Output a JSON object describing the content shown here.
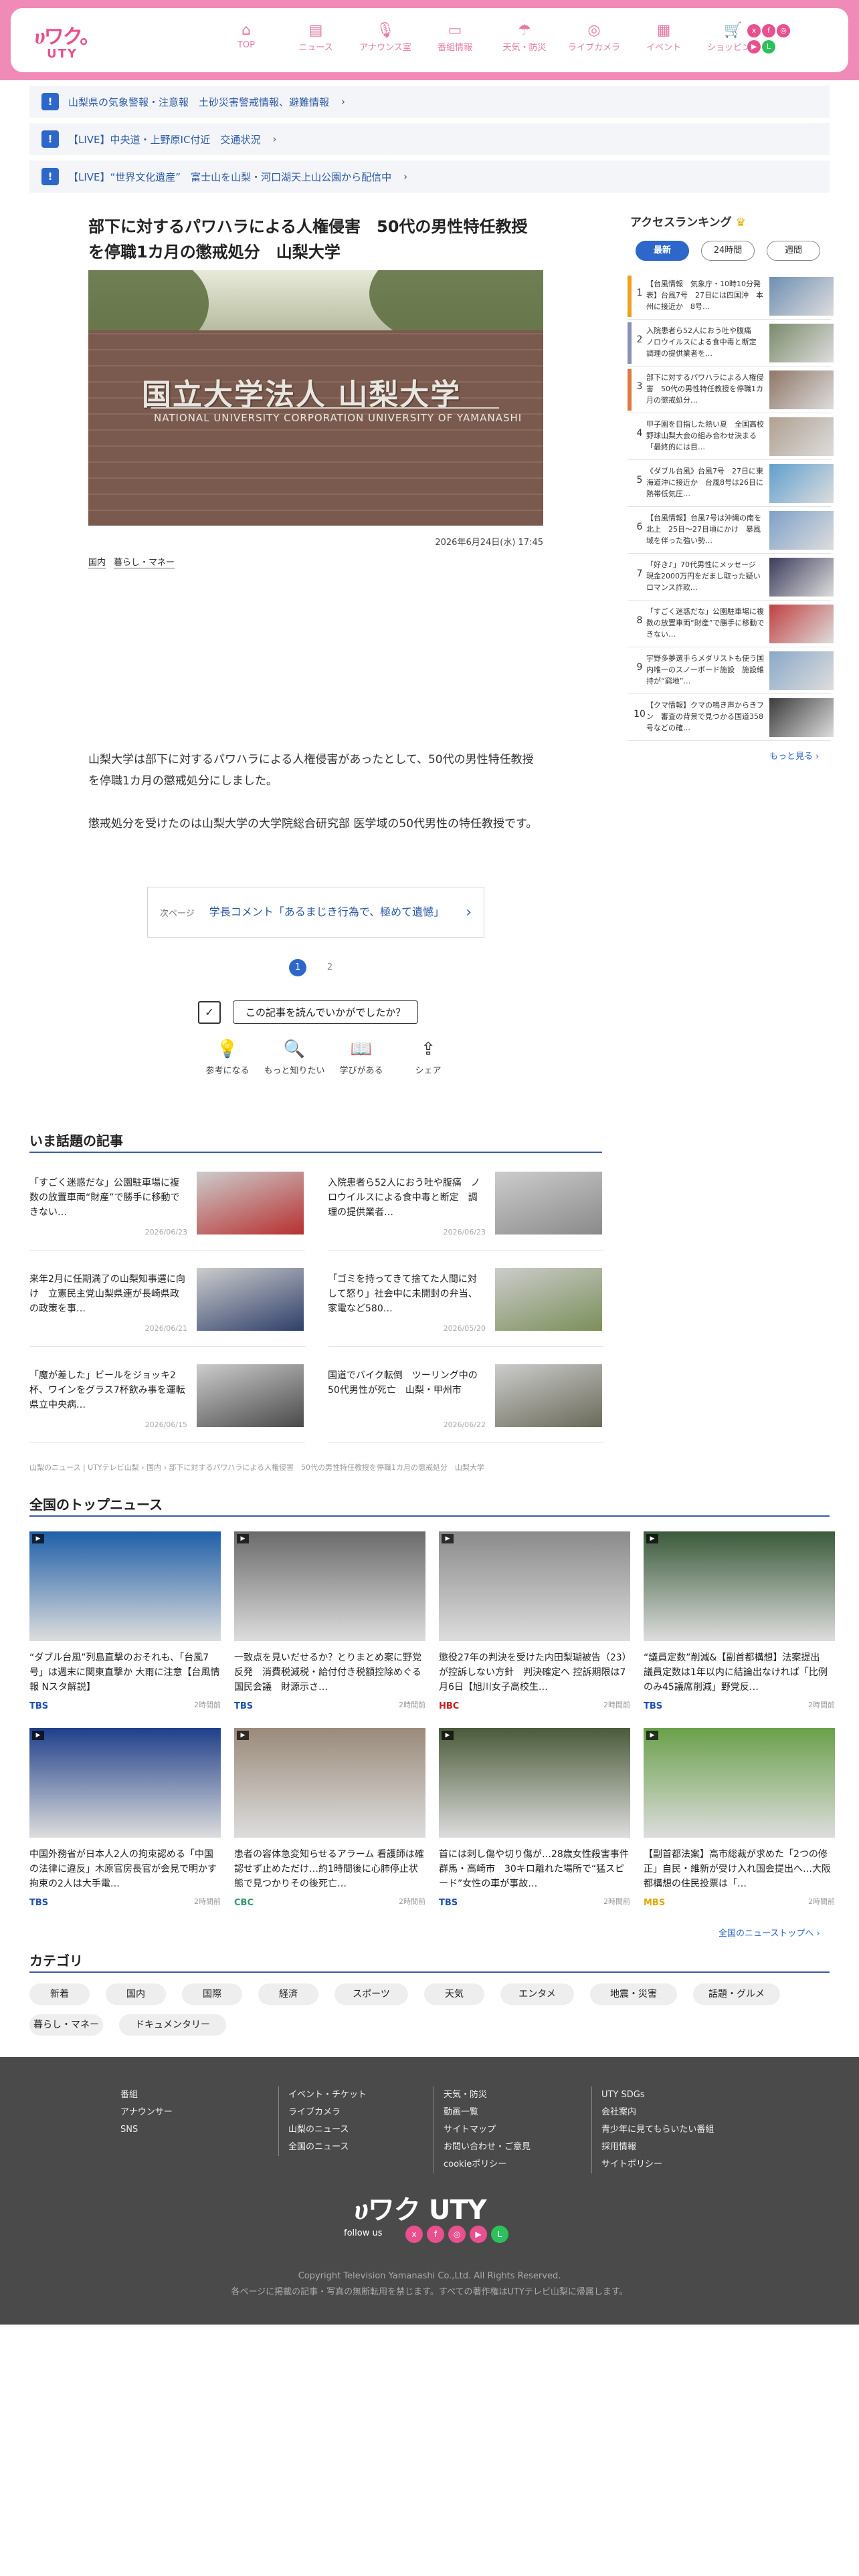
{
  "header": {
    "logo_text": "ሀワク。",
    "logo_sub": "UTY",
    "nav": [
      {
        "label": "TOP",
        "icon": "⌂"
      },
      {
        "label": "ニュース",
        "icon": "▤"
      },
      {
        "label": "アナウンス室",
        "icon": "🎙"
      },
      {
        "label": "番組情報",
        "icon": "▭"
      },
      {
        "label": "天気・防災",
        "icon": "☂"
      },
      {
        "label": "ライブカメラ",
        "icon": "◎"
      },
      {
        "label": "イベント",
        "icon": "▦"
      },
      {
        "label": "ショッピング",
        "icon": "🛒"
      }
    ],
    "sns": [
      "x",
      "f",
      "◎",
      "▶",
      "L"
    ]
  },
  "alerts": [
    "山梨県の気象警報・注意報　土砂災害警戒情報、避難情報",
    "【LIVE】中央道・上野原IC付近　交通状況",
    "【LIVE】“世界文化遺産”　富士山を山梨・河口湖天上山公園から配信中"
  ],
  "article": {
    "title": "部下に対するパワハラによる人権侵害　50代の男性特任教授を停職1カ月の懲戒処分　山梨大学",
    "sign_main": "国立大学法人 山梨大学",
    "sign_sub": "NATIONAL UNIVERSITY CORPORATION   UNIVERSITY OF YAMANASHI",
    "date": "2026年6月24日(水) 17:45",
    "tags": [
      "国内",
      "暮らし・マネー"
    ],
    "body": [
      "山梨大学は部下に対するパワハラによる人権侵害があったとして、50代の男性特任教授を停職1カ月の懲戒処分にしました。",
      "懲戒処分を受けたのは山梨大学の大学院総合研究部 医学域の50代男性の特任教授です。"
    ],
    "next_label": "次ページ",
    "next_title": "学長コメント「あるまじき行為で、極めて遺憾」",
    "pages": [
      "1",
      "2"
    ],
    "feedback_q": "この記事を読んでいかがでしたか？",
    "reactions": [
      {
        "label": "参考になる",
        "icon": "💡"
      },
      {
        "label": "もっと知りたい",
        "icon": "🔍"
      },
      {
        "label": "学びがある",
        "icon": "📖"
      },
      {
        "label": "シェア",
        "icon": "⇪"
      }
    ]
  },
  "ranking": {
    "title": "アクセスランキング",
    "tabs": [
      "最新",
      "24時間",
      "週間"
    ],
    "items": [
      {
        "num": "1",
        "text": "【台風情報　気象庁・10時10分発表】台風7号　27日には四国沖　本州に接近か　8号…",
        "color": "#f0a020"
      },
      {
        "num": "2",
        "text": "入院患者ら52人におう吐や腹痛　ノロウイルスによる食中毒と断定　調理の提供業者を…",
        "color": "#8a8fb8"
      },
      {
        "num": "3",
        "text": "部下に対するパワハラによる人権侵害　50代の男性特任教授を停職1カ月の懲戒処分…",
        "color": "#e07a40"
      },
      {
        "num": "4",
        "text": "甲子園を目指した熱い夏　全国高校野球山梨大会の組み合わせ決まる「最終的には目…",
        "color": ""
      },
      {
        "num": "5",
        "text": "《ダブル台風》台風7号　27日に東海道沖に接近か　台風8号は26日に熱帯低気圧…",
        "color": ""
      },
      {
        "num": "6",
        "text": "【台風情報】台風7号は沖縄の南を北上　25日〜27日頃にかけ　暴風域を伴った強い勢…",
        "color": ""
      },
      {
        "num": "7",
        "text": "「好き♪」70代男性にメッセージ　現金2000万円をだまし取った疑い　ロマンス詐欺…",
        "color": ""
      },
      {
        "num": "8",
        "text": "「すごく迷惑だな」公園駐車場に複数の放置車両“財産”で勝手に移動できない…",
        "color": ""
      },
      {
        "num": "9",
        "text": "宇野多夢選手らメダリストも使う国内唯一のスノーボード施設　施設維持が“窮地”…",
        "color": ""
      },
      {
        "num": "10",
        "text": "【クマ情報】クマの鳴き声からきフン　審査の背景で見つかる国道358号などの確…",
        "color": ""
      }
    ],
    "more": "もっと見る ›"
  },
  "hot": {
    "title": "いま話題の記事",
    "items": [
      {
        "text": "「すごく迷惑だな」公園駐車場に複数の放置車両“財産”で勝手に移動できない…",
        "date": "2026/06/23"
      },
      {
        "text": "入院患者ら52人におう吐や腹痛　ノロウイルスによる食中毒と断定　調理の提供業者…",
        "date": "2026/06/23"
      },
      {
        "text": "来年2月に任期満了の山梨知事選に向け　立憲民主党山梨県連が長崎県政の政策を事…",
        "date": "2026/06/21"
      },
      {
        "text": "「ゴミを持ってきて捨てた人間に対して怒り」社会中に未開封の弁当、家電など580…",
        "date": "2026/05/20"
      },
      {
        "text": "「魔が差した」ビールをジョッキ2杯、ワインをグラス7杯飲み事を運転　県立中央病…",
        "date": "2026/06/15"
      },
      {
        "text": "国道でバイク転倒　ツーリング中の50代男性が死亡　山梨・甲州市",
        "date": "2026/06/22"
      }
    ]
  },
  "breadcrumb": "山梨のニュース | UTYテレビ山梨 › 国内 › 部下に対するパワハラによる人権侵害　50代の男性特任教授を停職1カ月の懲戒処分　山梨大学",
  "topnews": {
    "title": "全国のトップニュース",
    "items": [
      {
        "text": "“ダブル台風”列島直撃のおそれも、「台風7号」は週末に関東直撃か 大雨に注意【台風情報 Nスタ解説】",
        "src": "TBS",
        "time": "2時間前",
        "src_color": "#1d4fb3"
      },
      {
        "text": "一致点を見いだせるか？とりまとめ案に野党反発　消費税減税・給付付き税額控除めぐる国民会議　財源示さ…",
        "src": "TBS",
        "time": "2時間前",
        "src_color": "#1d4fb3"
      },
      {
        "text": "懲役27年の判決を受けた内田梨瑚被告（23）が控訴しない方針　判決確定へ 控訴期限は7月6日【旭川女子高校生…",
        "src": "HBC",
        "time": "2時間前",
        "src_color": "#c8201e"
      },
      {
        "text": "“議員定数”削減&【副首都構想】法案提出　議員定数は1年以内に結論出なければ「比例のみ45議席削減」野党反…",
        "src": "TBS",
        "time": "2時間前",
        "src_color": "#1d4fb3"
      },
      {
        "text": "中国外務省が日本人2人の拘束認める「中国の法律に違反」木原官房長官が会見で明かす　拘束の2人は大手電…",
        "src": "TBS",
        "time": "2時間前",
        "src_color": "#1d4fb3"
      },
      {
        "text": "患者の容体急変知らせるアラーム 看護師は確認せず止めただけ…約1時間後に心肺停止状態で見つかりその後死亡…",
        "src": "CBC",
        "time": "2時間前",
        "src_color": "#2a9d6a"
      },
      {
        "text": "首には刺し傷や切り傷が…28歳女性殺害事件　群馬・高崎市　30キロ離れた場所で“猛スピード”女性の車が事故…",
        "src": "TBS",
        "time": "2時間前",
        "src_color": "#1d4fb3"
      },
      {
        "text": "【副首都法案】高市総裁が求めた「2つの修正」自民・維新が受け入れ国会提出へ…大阪都構想の住民投票は「…",
        "src": "MBS",
        "time": "2時間前",
        "src_color": "#e0a800"
      }
    ],
    "more": "全国のニューストップへ ›"
  },
  "categories": {
    "title": "カテゴリ",
    "items": [
      "新着",
      "国内",
      "国際",
      "経済",
      "スポーツ",
      "天気",
      "エンタメ",
      "地震・災害",
      "話題・グルメ",
      "暮らし・マネー",
      "ドキュメンタリー"
    ]
  },
  "footer": {
    "cols": [
      [
        "番組",
        "アナウンサー",
        "SNS"
      ],
      [
        "イベント・チケット",
        "ライブカメラ",
        "山梨のニュース",
        "全国のニュース"
      ],
      [
        "天気・防災",
        "動画一覧",
        "サイトマップ",
        "お問い合わせ・ご意見",
        "cookieポリシー"
      ],
      [
        "UTY SDGs",
        "会社案内",
        "青少年に見てもらいたい番組",
        "採用情報",
        "サイトポリシー"
      ]
    ],
    "logo": "ሀワク UTY",
    "follow": "follow us",
    "copyright": "Copyright Television Yamanashi Co.,Ltd. All Rights Reserved.",
    "notice": "各ページに掲載の記事・写真の無断転用を禁じます。すべての著作権はUTYテレビ山梨に帰属します。"
  }
}
